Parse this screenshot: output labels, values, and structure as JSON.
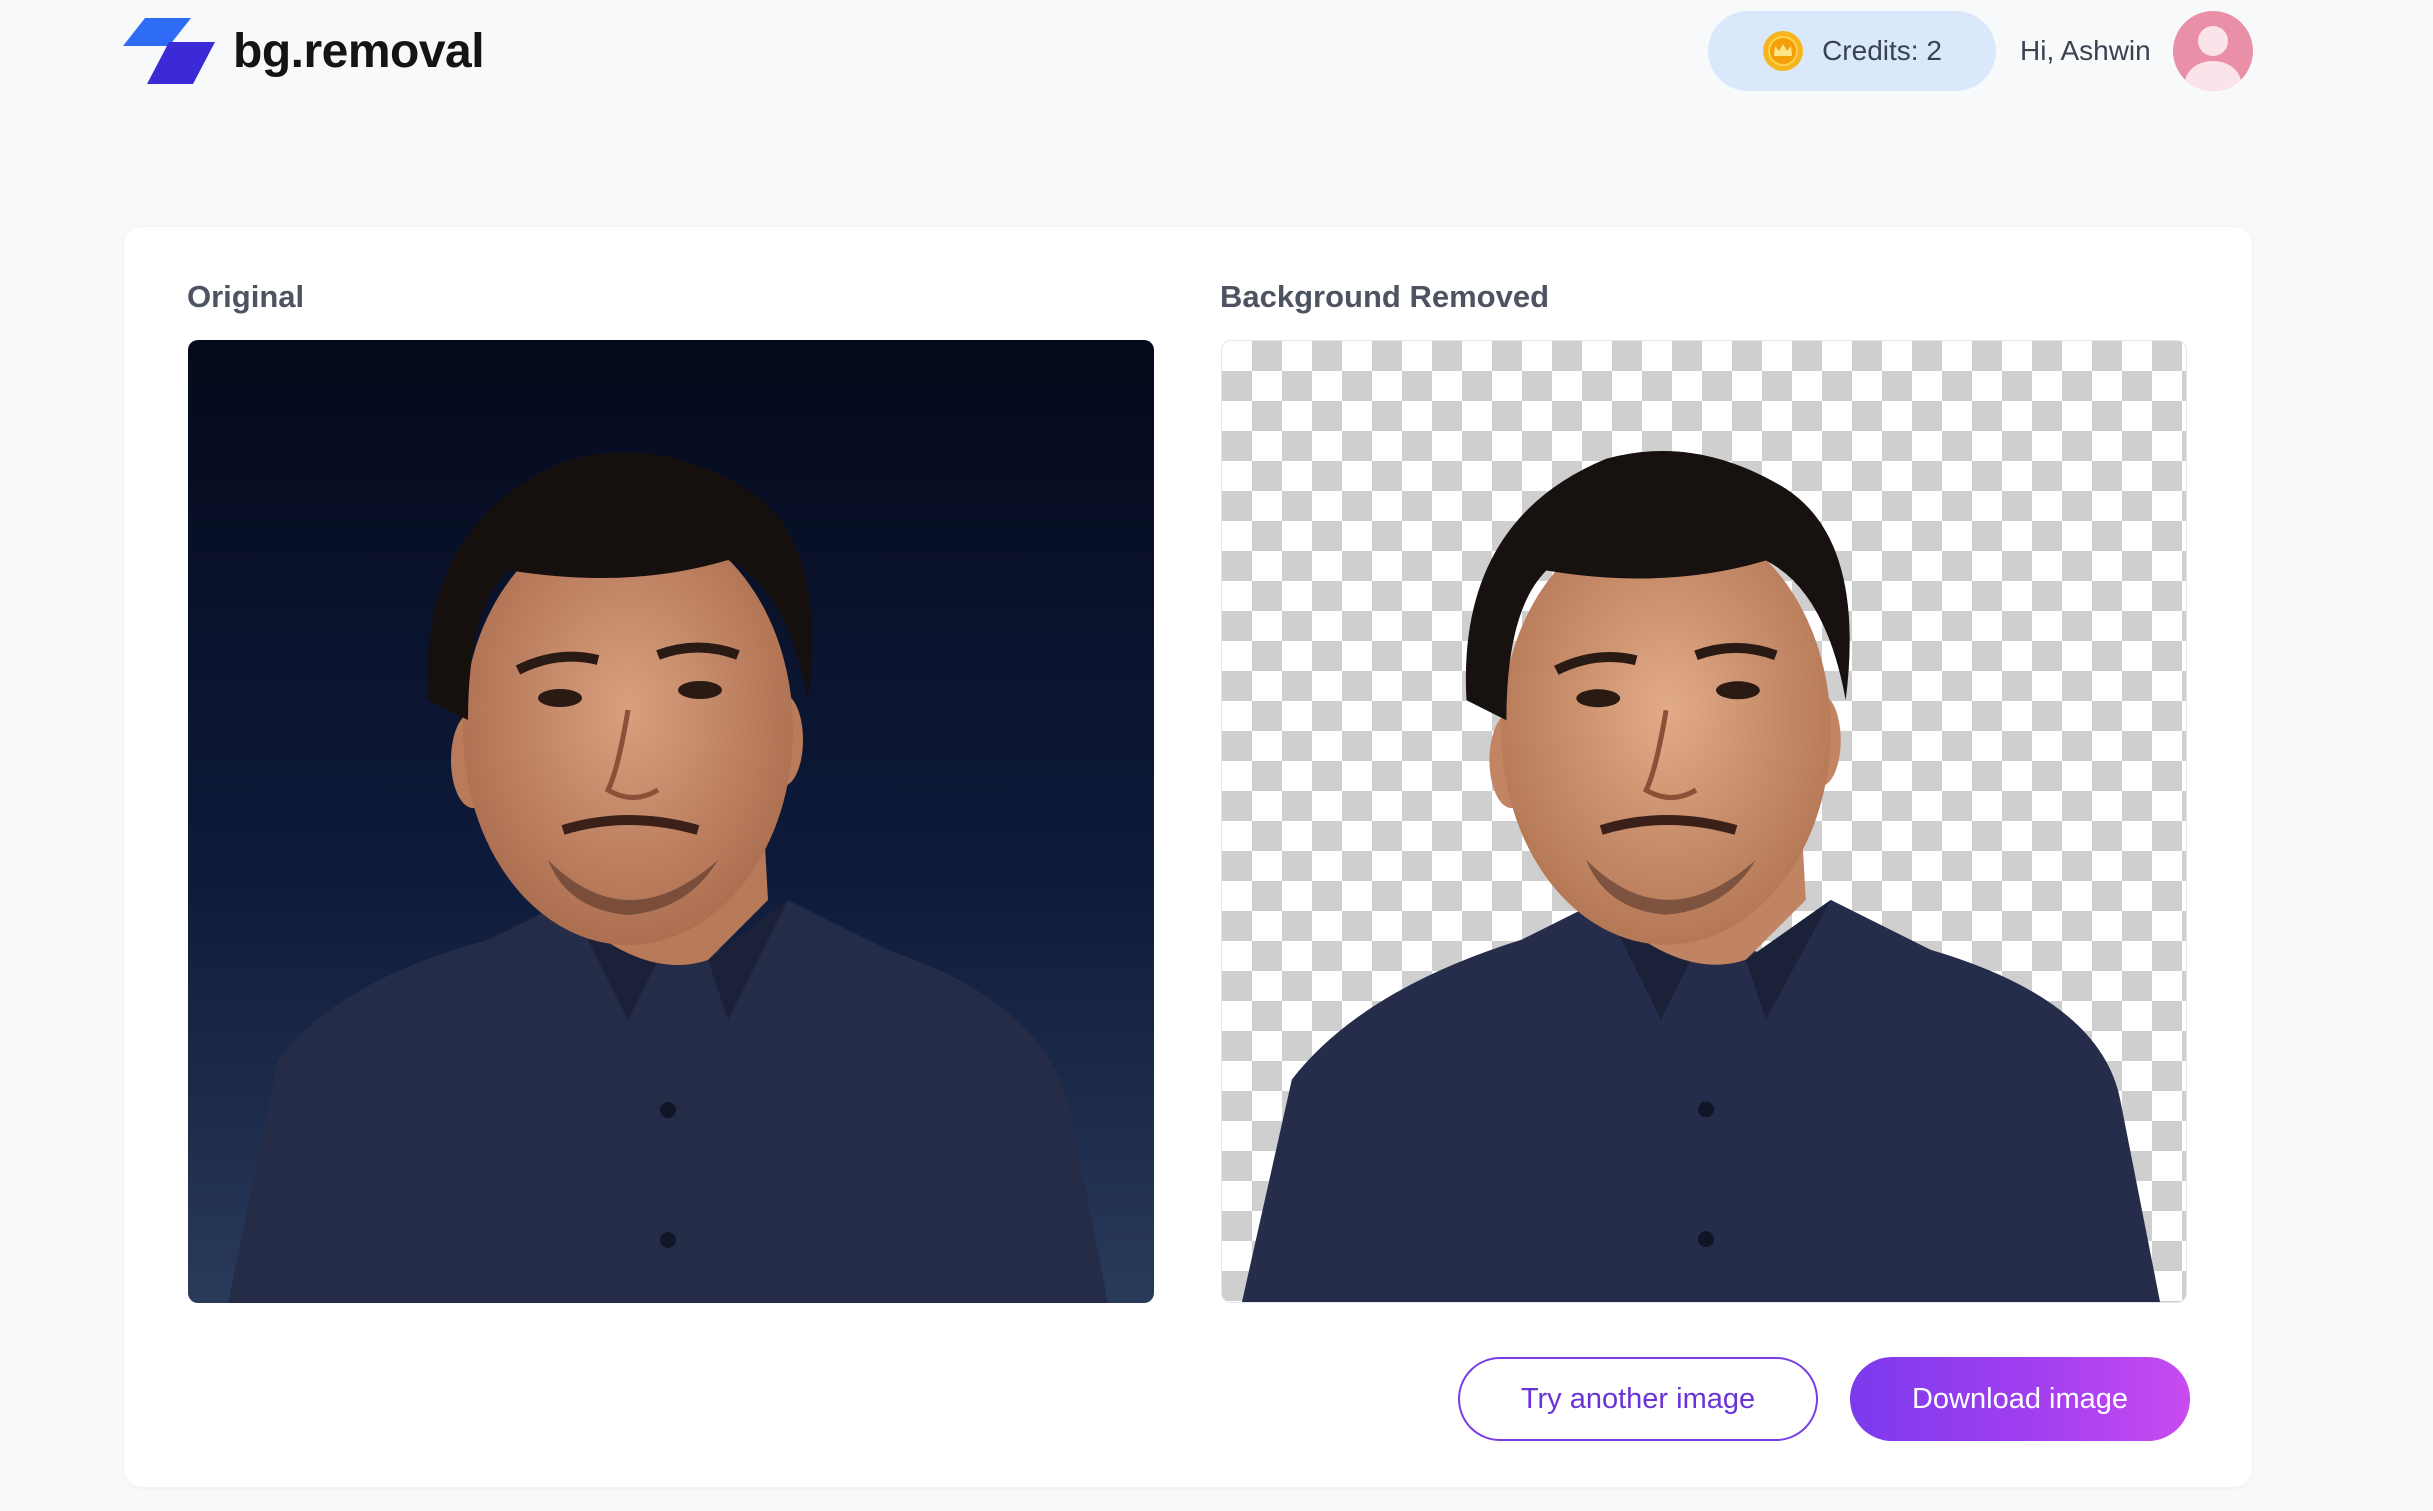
{
  "header": {
    "brand_name": "bg.removal",
    "credits_label": "Credits: 2",
    "greeting": "Hi, Ashwin"
  },
  "panels": {
    "original_title": "Original",
    "removed_title": "Background Removed"
  },
  "actions": {
    "try_another_label": "Try another image",
    "download_label": "Download image"
  },
  "icons": {
    "logo": "logo-icon",
    "coin": "coin-icon",
    "avatar": "user-avatar-icon"
  },
  "colors": {
    "page_background": "#f8f9fb",
    "credits_pill": "#d9e9fb",
    "brand_blue": "#2f6cf6",
    "brand_indigo": "#3b2ad6",
    "accent_purple": "#7c3aed",
    "accent_pink": "#c84bf0",
    "avatar_pink": "#ea8fa8",
    "photo_background": "#0c1530",
    "shirt_navy": "#242c48"
  }
}
